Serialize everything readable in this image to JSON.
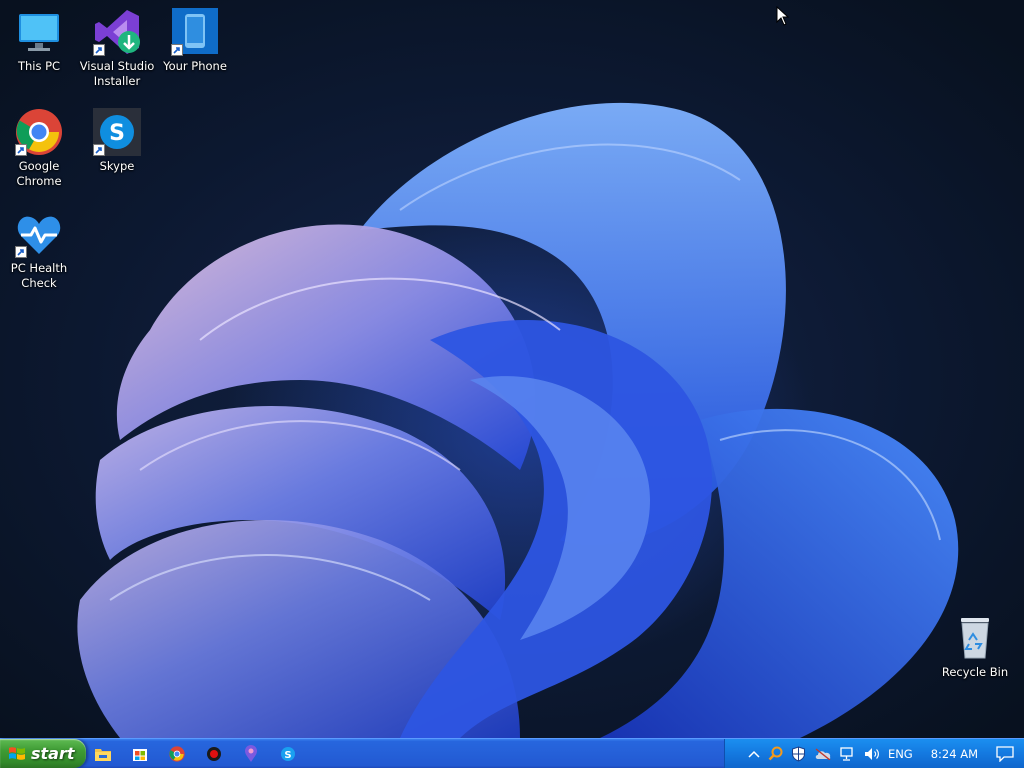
{
  "desktop": {
    "icons": [
      {
        "label": "This PC",
        "icon": "this-pc-icon"
      },
      {
        "label": "Visual Studio Installer",
        "icon": "visual-studio-installer-icon"
      },
      {
        "label": "Your Phone",
        "icon": "your-phone-icon"
      },
      {
        "label": "Google Chrome",
        "icon": "chrome-icon"
      },
      {
        "label": "Skype",
        "icon": "skype-icon"
      },
      {
        "label": "PC Health Check",
        "icon": "pc-health-check-icon"
      },
      {
        "label": "Recycle Bin",
        "icon": "recycle-bin-icon"
      }
    ]
  },
  "taskbar": {
    "start_label": "start",
    "quick_launch": [
      {
        "icon": "file-explorer-icon"
      },
      {
        "icon": "store-icon"
      },
      {
        "icon": "chrome-icon"
      },
      {
        "icon": "record-icon"
      },
      {
        "icon": "maps-pin-icon"
      },
      {
        "icon": "skype-icon"
      }
    ],
    "tray": {
      "language": "ENG",
      "time": "8:24 AM",
      "icons": [
        "chevron-up-icon",
        "search-icon",
        "security-shield-icon",
        "onedrive-icon",
        "network-icon",
        "volume-icon",
        "notification-icon"
      ]
    }
  },
  "colors": {
    "taskbar": "#2560d8",
    "start_button": "#3e9b34",
    "tray": "#1479e0",
    "wallpaper_bloom": "#3b5de0"
  }
}
